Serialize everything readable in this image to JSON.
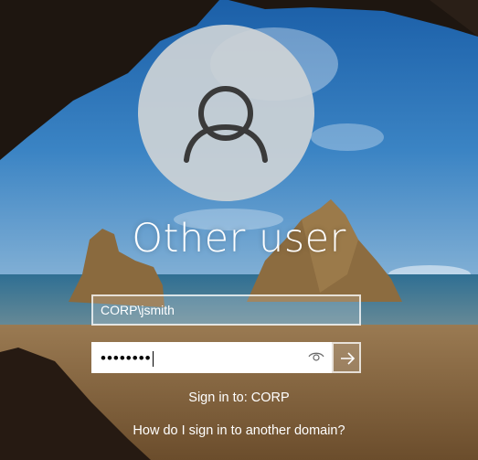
{
  "account": {
    "display_name": "Other user"
  },
  "form": {
    "username_value": "CORP\\jsmith",
    "password_mask": "••••••••"
  },
  "sign_in_to": "Sign in to: CORP",
  "help_link": "How do I sign in to another domain?",
  "icons": {
    "avatar": "user-silhouette-icon",
    "reveal": "eye-icon",
    "submit": "arrow-right-icon"
  },
  "colors": {
    "text": "#ffffff",
    "field_bg": "#ffffff"
  }
}
